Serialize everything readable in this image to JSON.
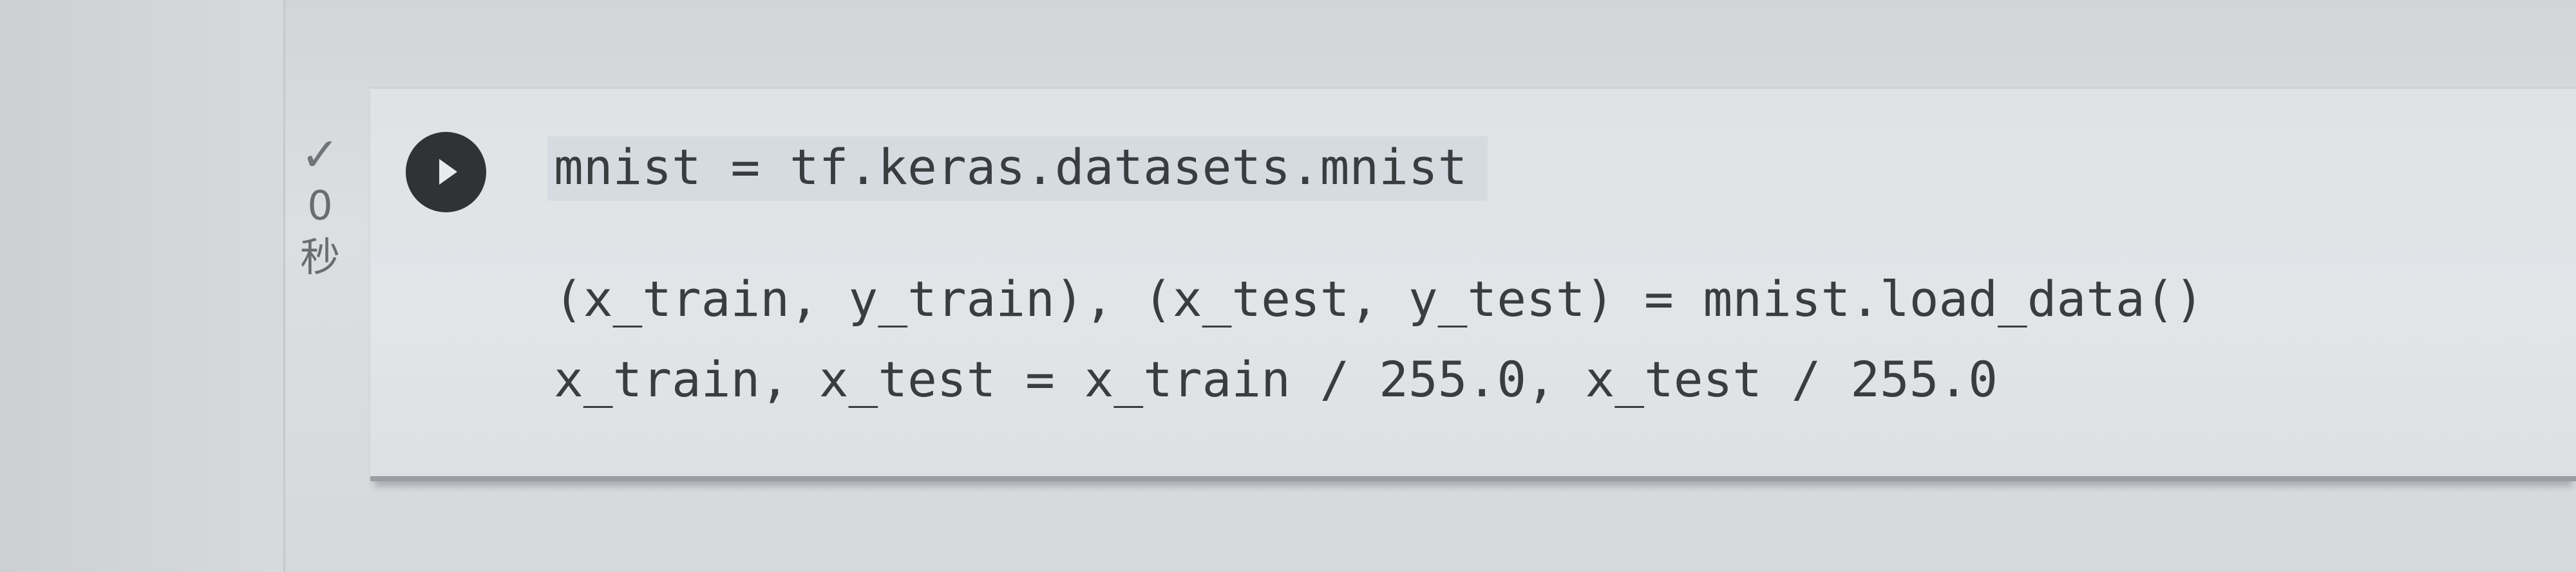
{
  "cell": {
    "status": {
      "check_icon": "✓",
      "elapsed_value": "0",
      "elapsed_unit": "秒"
    },
    "run_button": {
      "icon": "play-icon"
    },
    "code_lines": [
      "mnist = tf.keras.datasets.mnist",
      "(x_train, y_train), (x_test, y_test) = mnist.load_data()",
      "x_train, x_test = x_train / 255.0, x_test / 255.0"
    ]
  }
}
